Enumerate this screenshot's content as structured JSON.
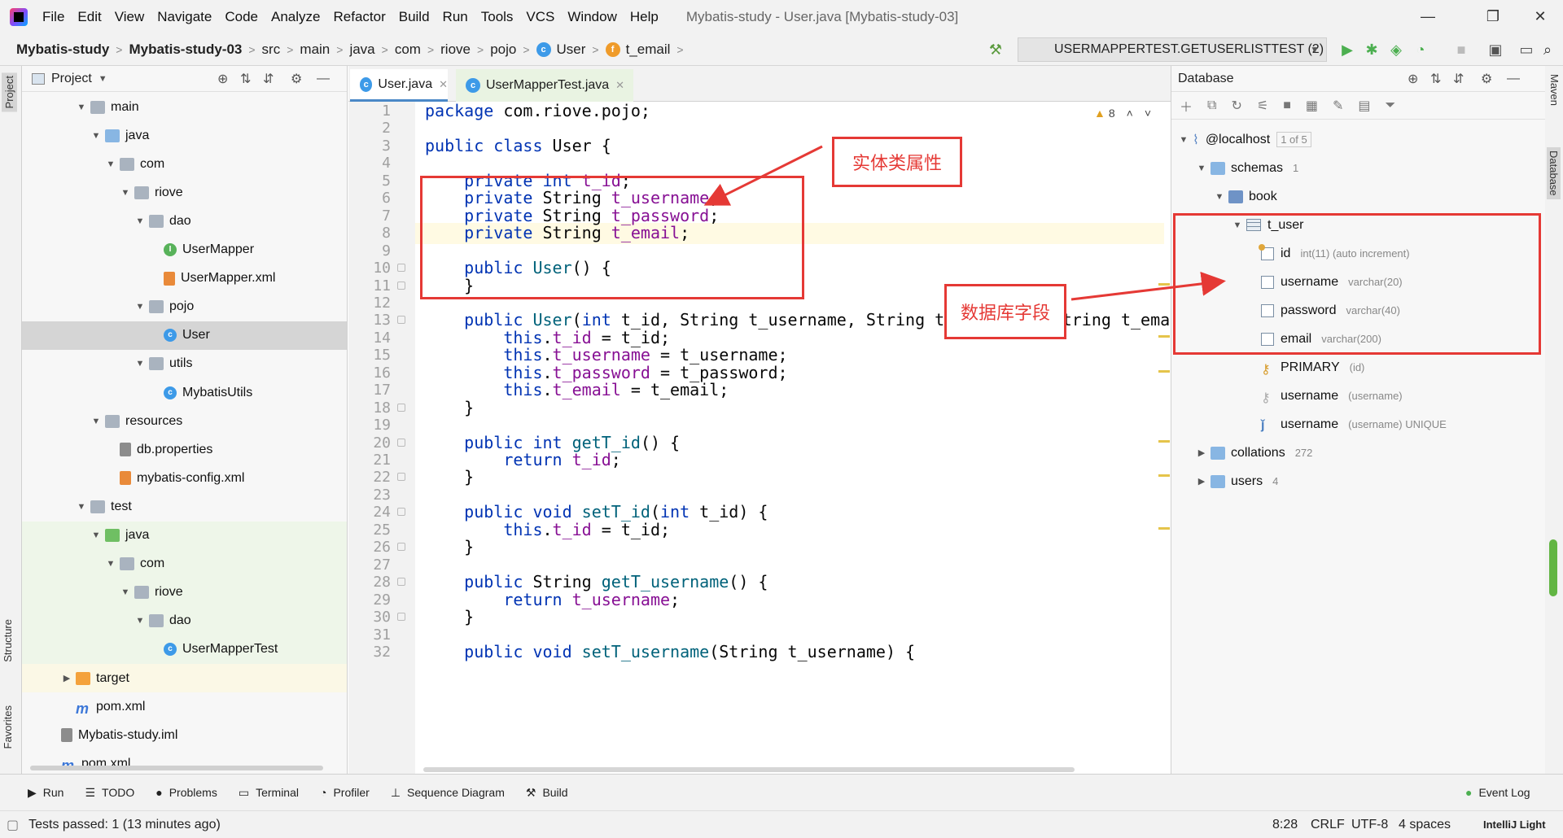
{
  "menubar": {
    "items": [
      "File",
      "Edit",
      "View",
      "Navigate",
      "Code",
      "Analyze",
      "Refactor",
      "Build",
      "Run",
      "Tools",
      "VCS",
      "Window",
      "Help"
    ],
    "window_title": "Mybatis-study - User.java [Mybatis-study-03]",
    "minimize": "—",
    "maximize": "❐",
    "close": "✕"
  },
  "navbar": {
    "crumbs": [
      "Mybatis-study",
      "Mybatis-study-03",
      "src",
      "main",
      "java",
      "com",
      "riove",
      "pojo",
      "User",
      "t_email"
    ],
    "run_config": "USERMAPPERTEST.GETUSERLISTTEST (2)"
  },
  "sidebar_left": {
    "project_label": "Project",
    "structure_label": "Structure",
    "favorites_label": "Favorites"
  },
  "project": {
    "title": "Project",
    "tree": [
      {
        "label": "main",
        "indent": 0
      },
      {
        "label": "java",
        "indent": 1
      },
      {
        "label": "com",
        "indent": 2
      },
      {
        "label": "riove",
        "indent": 3
      },
      {
        "label": "dao",
        "indent": 4
      },
      {
        "label": "UserMapper",
        "indent": 5
      },
      {
        "label": "UserMapper.xml",
        "indent": 5
      },
      {
        "label": "pojo",
        "indent": 4
      },
      {
        "label": "User",
        "indent": 5
      },
      {
        "label": "utils",
        "indent": 4
      },
      {
        "label": "MybatisUtils",
        "indent": 5
      },
      {
        "label": "resources",
        "indent": 1
      },
      {
        "label": "db.properties",
        "indent": 2
      },
      {
        "label": "mybatis-config.xml",
        "indent": 2
      },
      {
        "label": "test",
        "indent": 0
      },
      {
        "label": "java",
        "indent": 1
      },
      {
        "label": "com",
        "indent": 2
      },
      {
        "label": "riove",
        "indent": 3
      },
      {
        "label": "dao",
        "indent": 4
      },
      {
        "label": "UserMapperTest",
        "indent": 5
      },
      {
        "label": "target",
        "indent": -1
      },
      {
        "label": "pom.xml",
        "indent": -1
      },
      {
        "label": "Mybatis-study.iml",
        "indent": -2
      },
      {
        "label": "pom.xml",
        "indent": -2
      }
    ]
  },
  "editor": {
    "tabs": [
      {
        "label": "User.java"
      },
      {
        "label": "UserMapperTest.java"
      }
    ],
    "warnings": "8",
    "line_numbers": [
      "1",
      "2",
      "3",
      "4",
      "5",
      "6",
      "7",
      "8",
      "9",
      "10",
      "11",
      "12",
      "13",
      "14",
      "15",
      "16",
      "17",
      "18",
      "19",
      "20",
      "21",
      "22",
      "23",
      "24",
      "25",
      "26",
      "27",
      "28",
      "29",
      "30",
      "31",
      "32"
    ]
  },
  "annotations": {
    "entity_label": "实体类属性",
    "db_label": "数据库字段"
  },
  "database": {
    "title": "Database",
    "host": "@localhost",
    "host_badge": "1 of 5",
    "schemas": "schemas",
    "schemas_count": "1",
    "db_name": "book",
    "table": "t_user",
    "columns": [
      {
        "name": "id",
        "type": "int(11) (auto increment)"
      },
      {
        "name": "username",
        "type": "varchar(20)"
      },
      {
        "name": "password",
        "type": "varchar(40)"
      },
      {
        "name": "email",
        "type": "varchar(200)"
      }
    ],
    "keys": [
      {
        "name": "PRIMARY",
        "type": "(id)"
      },
      {
        "name": "username",
        "type": "(username)"
      },
      {
        "name": "username",
        "type": "(username) UNIQUE"
      }
    ],
    "collations": "collations",
    "collations_count": "272",
    "users": "users",
    "users_count": "4"
  },
  "right_strip": {
    "maven": "Maven",
    "database": "Database"
  },
  "bottom_tools": [
    "Run",
    "TODO",
    "Problems",
    "Terminal",
    "Profiler",
    "Sequence Diagram",
    "Build"
  ],
  "event_log": "Event Log",
  "status": {
    "message": "Tests passed: 1 (13 minutes ago)",
    "position": "8:28",
    "line_sep": "CRLF",
    "encoding": "UTF-8",
    "indent": "4 spaces",
    "theme": "IntelliJ Light"
  }
}
